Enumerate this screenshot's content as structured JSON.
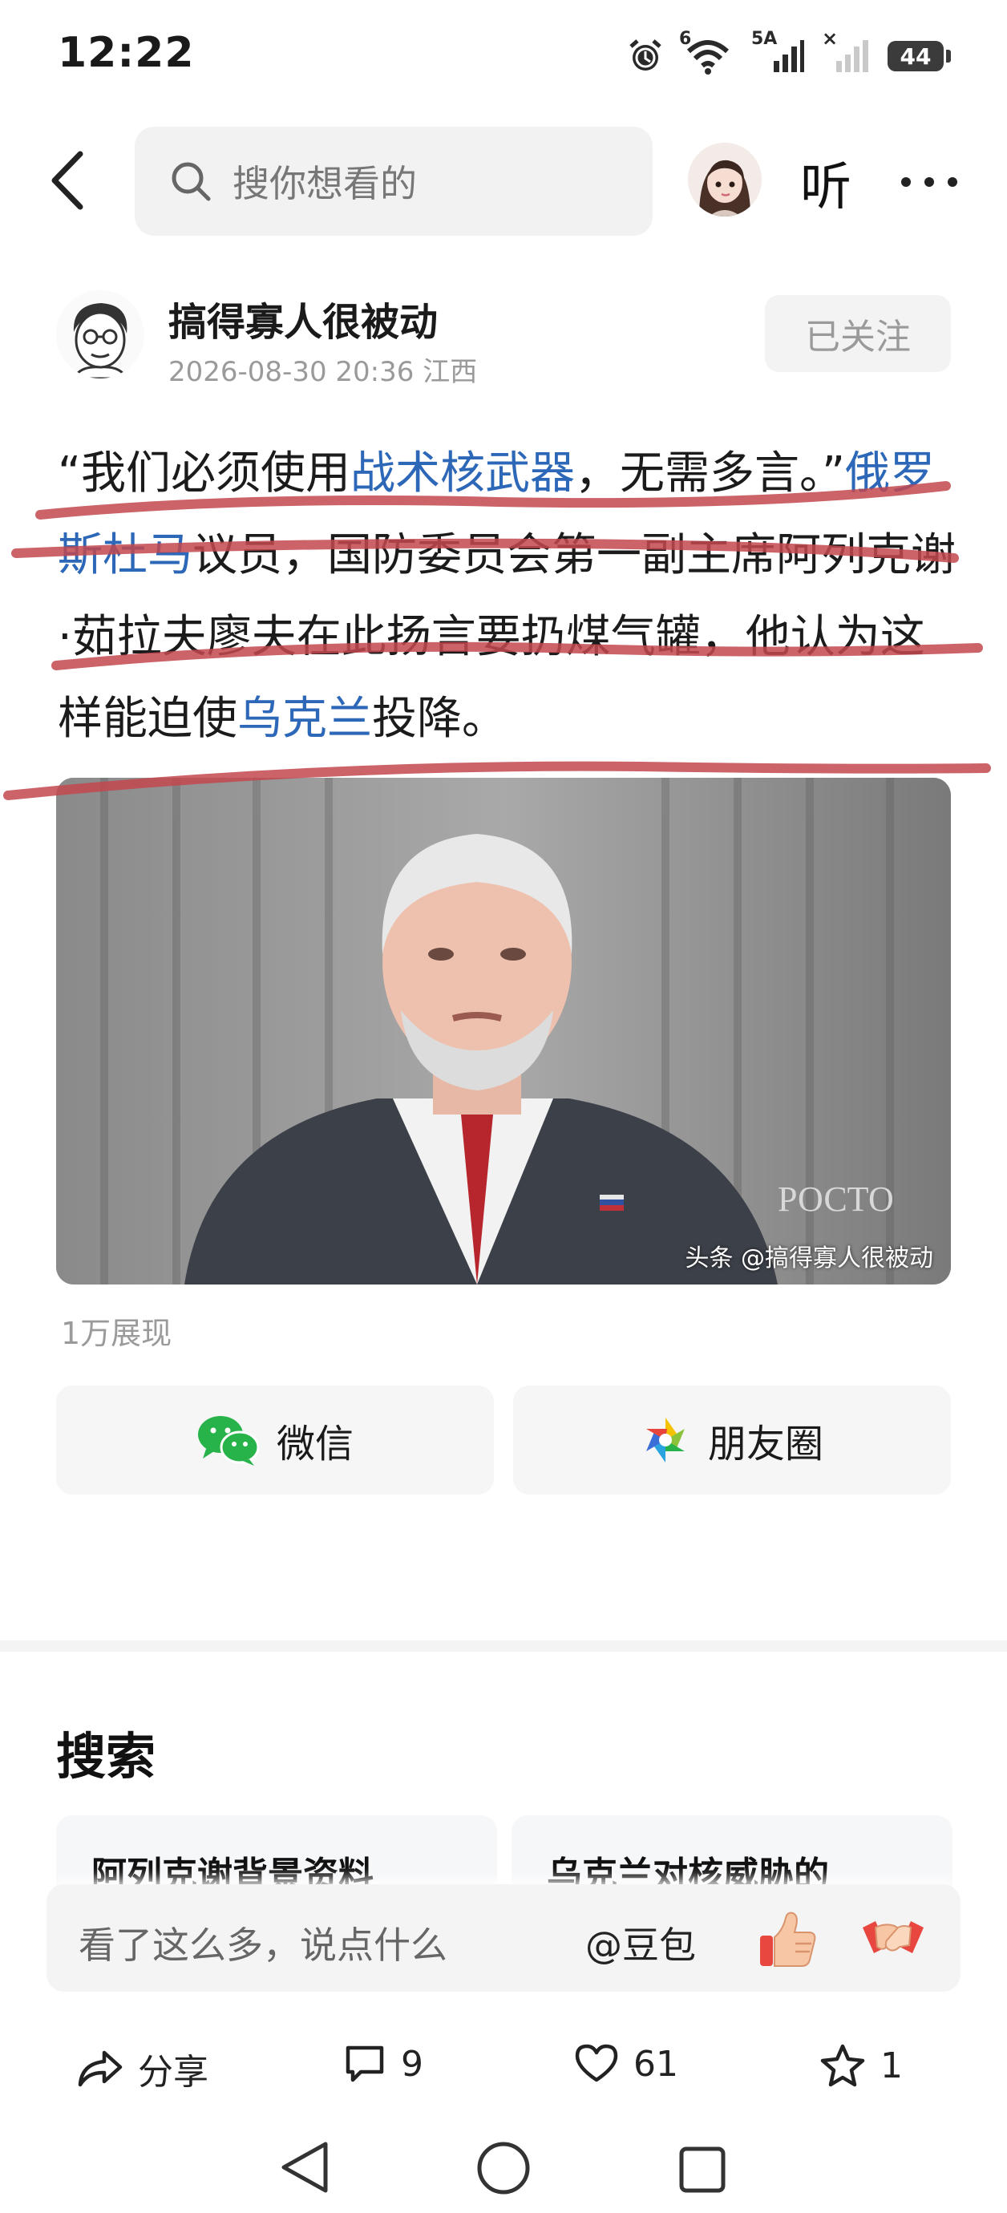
{
  "status_bar": {
    "time": "12:22",
    "network_labels": [
      "6",
      "5A",
      "×"
    ],
    "battery": "44"
  },
  "topbar": {
    "search_placeholder": "搜你想看的",
    "listen_label": "听"
  },
  "author": {
    "name": "搞得寡人很被动",
    "meta": "2026-08-30 20:36 江西",
    "follow_label": "已关注"
  },
  "article": {
    "segments": [
      {
        "text": "“我们必须使用",
        "link": false
      },
      {
        "text": "战术核武器",
        "link": true
      },
      {
        "text": "，无需多言。”",
        "link": false
      },
      {
        "text": "俄罗斯杜马",
        "link": true
      },
      {
        "text": "议员，国防委员会第一副主席阿列克谢·茹拉夫廖夫在此扬言要扔煤气罐，他认为这样能迫使",
        "link": false
      },
      {
        "text": "乌克兰",
        "link": true
      },
      {
        "text": "投降。",
        "link": false
      }
    ],
    "annotation_color": "#c2484f"
  },
  "media": {
    "watermark": "头条 @搞得寡人很被动",
    "backdrop_text": "РОСТО"
  },
  "views": "1万展现",
  "share": {
    "wechat_label": "微信",
    "moments_label": "朋友圈"
  },
  "search_section": {
    "title": "搜索",
    "suggestions": [
      "阿列克谢背景资料",
      "乌克兰对核威胁的"
    ]
  },
  "comment_bar": {
    "placeholder": "看了这么多，说点什么",
    "doubao_label": "@豆包"
  },
  "actions": {
    "share_label": "分享",
    "comment_count": "9",
    "like_count": "61",
    "favorite_count": "1"
  },
  "colors": {
    "link": "#2d67b8",
    "wechat_green": "#27b24a",
    "muted_text": "#9a9a9a"
  },
  "icons": [
    "alarm-icon",
    "wifi-icon",
    "signal-icon",
    "battery-icon",
    "back-arrow-icon",
    "search-icon",
    "more-icon",
    "wechat-icon",
    "moments-icon",
    "thumbs-up-icon",
    "handshake-icon",
    "share-icon",
    "comment-icon",
    "like-icon",
    "star-icon",
    "nav-back-icon",
    "nav-home-icon",
    "nav-recent-icon"
  ]
}
